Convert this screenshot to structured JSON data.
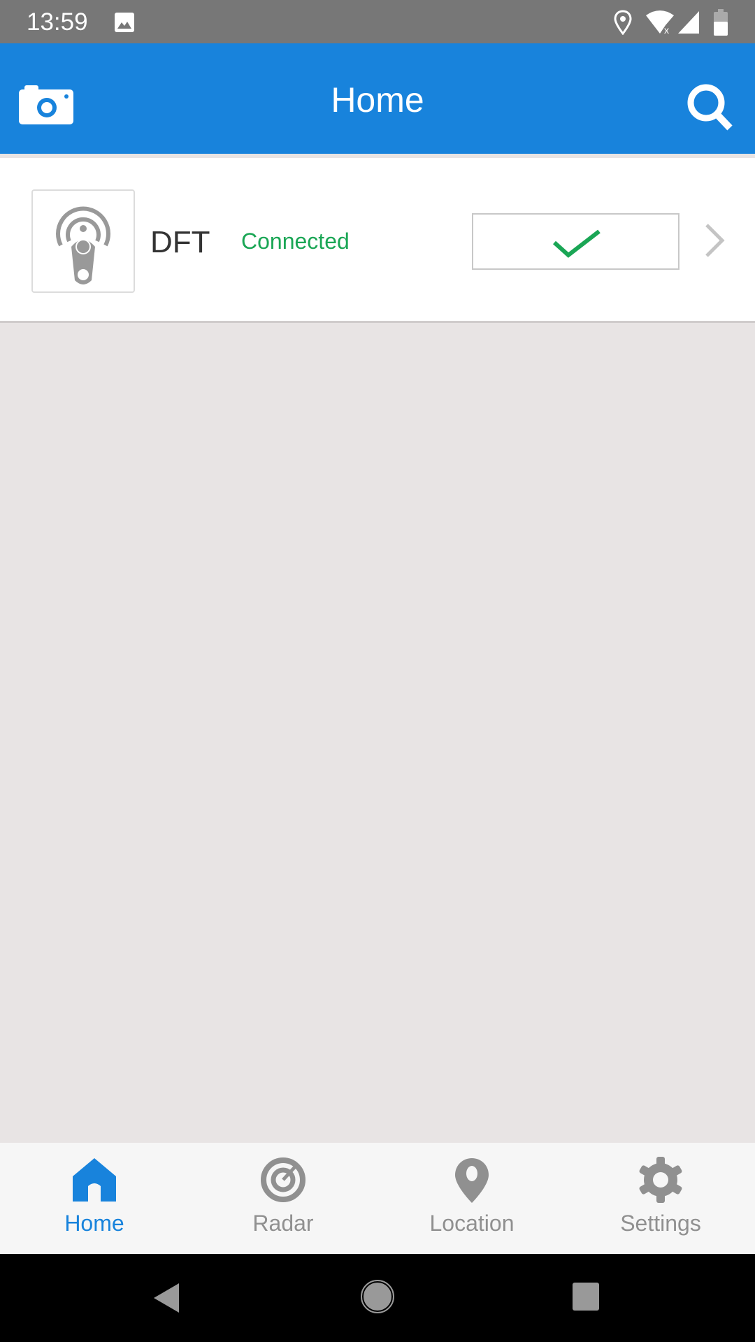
{
  "status_bar": {
    "time": "13:59",
    "icons": [
      "image-icon",
      "location-icon",
      "wifi-off-icon",
      "signal-icon",
      "battery-icon"
    ]
  },
  "app_bar": {
    "title": "Home",
    "left_icon": "camera-icon",
    "right_icon": "search-icon"
  },
  "devices": [
    {
      "name": "DFT",
      "status": "Connected",
      "status_color": "#1aa655",
      "checked": true,
      "icon": "beacon-tag-icon"
    }
  ],
  "bottom_nav": {
    "active_color": "#1883dc",
    "items": [
      {
        "label": "Home",
        "icon": "home-icon",
        "active": true
      },
      {
        "label": "Radar",
        "icon": "radar-icon",
        "active": false
      },
      {
        "label": "Location",
        "icon": "location-pin-icon",
        "active": false
      },
      {
        "label": "Settings",
        "icon": "gear-icon",
        "active": false
      }
    ]
  },
  "accent": "#1883dc"
}
